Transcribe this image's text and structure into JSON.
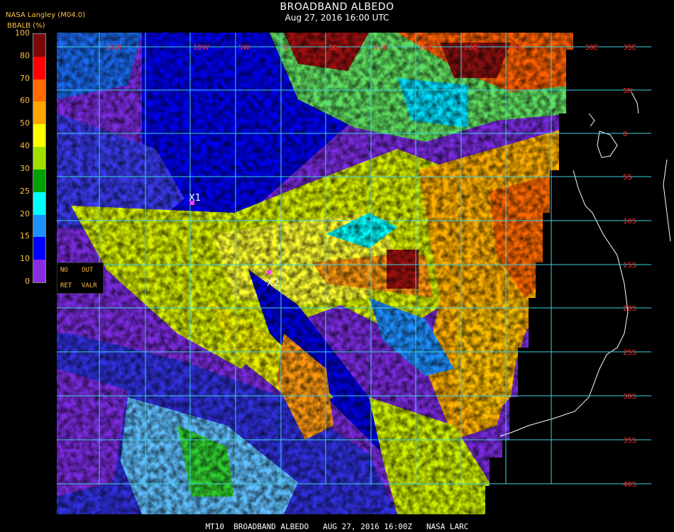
{
  "header": {
    "title": "BROADBAND ALBEDO",
    "date": "Aug 27, 2016 16:00 UTC",
    "credit": "NASA Langley (M04.0)"
  },
  "colorbar": {
    "label": "BBALB (%)",
    "ticks": [
      "100",
      "80",
      "70",
      "60",
      "50",
      "40",
      "30",
      "25",
      "20",
      "15",
      "10",
      "0"
    ],
    "colors": [
      "#7a0a0a",
      "#ff0000",
      "#ff6a00",
      "#ffa500",
      "#ffff00",
      "#a0e000",
      "#00a000",
      "#00ffff",
      "#1e90ff",
      "#0000ff",
      "#8a2be2"
    ]
  },
  "legend": {
    "no": "NO",
    "out": "OUT",
    "ret": "RET",
    "valr": "VALR"
  },
  "grid": {
    "lon_labels": [
      "15W",
      "10W",
      "5W",
      "0",
      "5E",
      "10E",
      "15E",
      "20E",
      "25E",
      "30E"
    ],
    "lat_labels": [
      "35E",
      "5N",
      "0",
      "5S",
      "10S",
      "15S",
      "20S",
      "25S",
      "30S",
      "35S",
      "40S"
    ]
  },
  "markers": [
    {
      "id": "X1",
      "label": "X1"
    },
    {
      "id": "X2",
      "label": "X2"
    }
  ],
  "footer": {
    "text": "MT10  BROADBAND ALBEDO   AUG 27, 2016 16:00Z   NASA LARC"
  },
  "colors": {
    "grid": "#40d0e0",
    "coast": "#ffffff",
    "labels": "#ff3030",
    "legend_text": "#ffbf40"
  }
}
